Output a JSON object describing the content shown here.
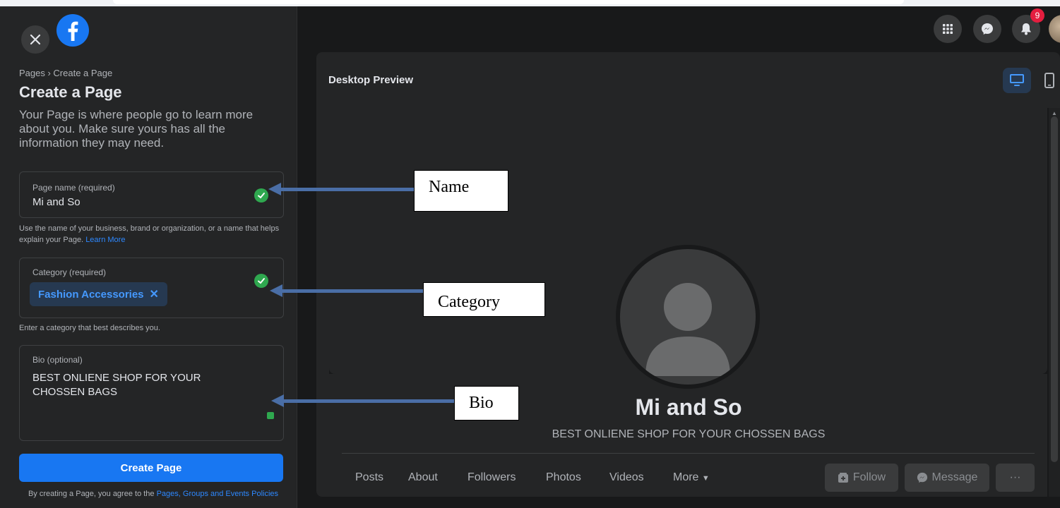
{
  "sidebar": {
    "breadcrumb": "Pages › Create a Page",
    "title": "Create a Page",
    "description": "Your Page is where people go to learn more about you. Make sure yours has all the information they may need.",
    "page_name": {
      "label": "Page name (required)",
      "value": "Mi and So",
      "help": "Use the name of your business, brand or organization, or a name that helps explain your Page.",
      "help_link": "Learn More"
    },
    "category": {
      "label": "Category (required)",
      "chip": "Fashion Accessories",
      "help": "Enter a category that best describes you."
    },
    "bio": {
      "label": "Bio (optional)",
      "value": "BEST ONLIENE SHOP FOR YOUR CHOSSEN BAGS"
    },
    "create_button": "Create Page",
    "terms_prefix": "By creating a Page, you agree to the",
    "terms_link": "Pages, Groups and Events Policies"
  },
  "topnav": {
    "notification_count": "9"
  },
  "preview": {
    "title": "Desktop Preview",
    "page_name": "Mi and So",
    "page_bio": "BEST ONLIENE SHOP FOR YOUR CHOSSEN BAGS",
    "tabs": [
      "Posts",
      "About",
      "Followers",
      "Photos",
      "Videos",
      "More"
    ],
    "follow_button": "Follow",
    "message_button": "Message",
    "more_button": "···"
  },
  "annotations": {
    "name": "Name",
    "category": "Category",
    "bio": "Bio"
  },
  "colors": {
    "accent": "#1877f2",
    "check": "#2fa84f",
    "annotation_arrow": "#4a6ea6"
  },
  "icons": [
    "close-icon",
    "facebook-logo-icon",
    "check-icon",
    "apps-grid-icon",
    "messenger-icon",
    "bell-icon",
    "desktop-icon",
    "mobile-icon",
    "follow-icon",
    "messenger-small-icon",
    "caret-down-icon"
  ]
}
